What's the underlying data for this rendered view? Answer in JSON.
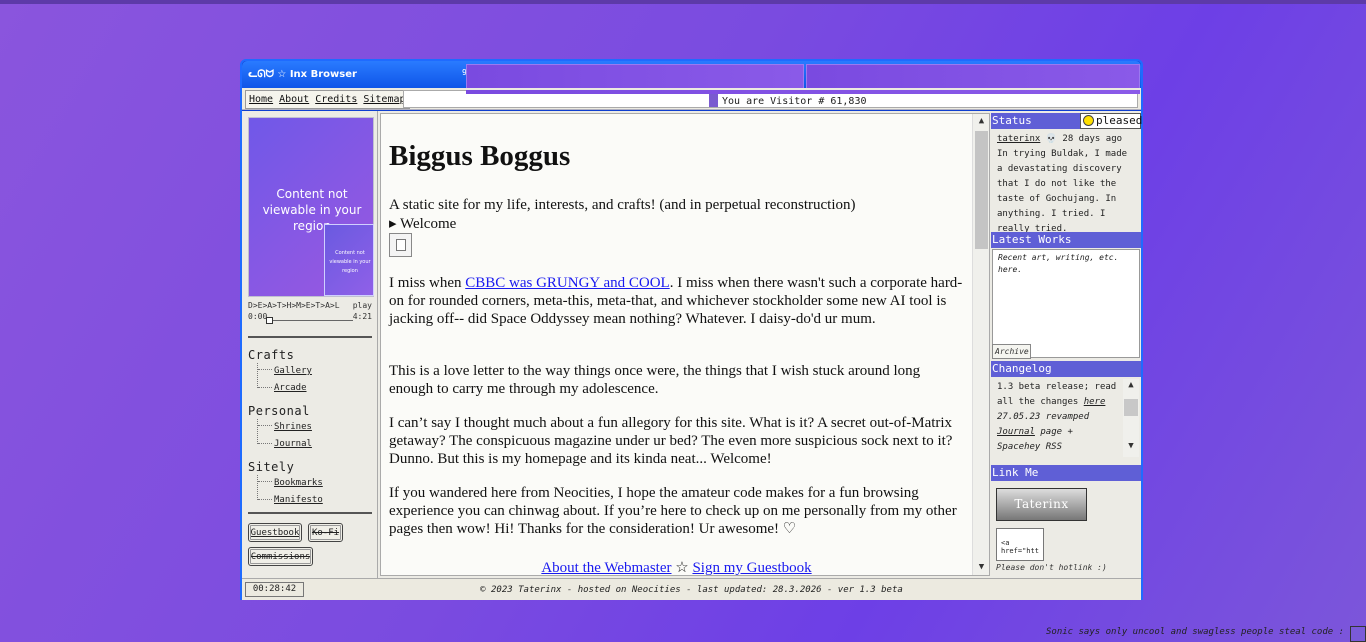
{
  "window": {
    "title": "ᓚᘏᗢ ☆ Inx Browser",
    "tab_number": "9"
  },
  "nav": {
    "items": [
      "Home",
      "About",
      "Credits",
      "Sitemap"
    ]
  },
  "visitor": "You are Visitor # 61,830",
  "player": {
    "blocked_message": "Content not viewable in your region",
    "mini_message": "Content not viewable in your region",
    "track_title": "D>E>A>T>H>M>E>T>A>L",
    "play_label": "play",
    "current_time": "0:00",
    "duration": "4:21",
    "progress": 0
  },
  "sidebar": {
    "sections": [
      {
        "title": "Crafts",
        "items": [
          "Gallery",
          "Arcade"
        ]
      },
      {
        "title": "Personal",
        "items": [
          "Shrines",
          "Journal"
        ]
      },
      {
        "title": "Sitely",
        "items": [
          "Bookmarks",
          "Manifesto"
        ]
      }
    ],
    "buttons": [
      "Guestbook",
      "Ko-Fi",
      "Commissions"
    ]
  },
  "main": {
    "heading": "Biggus Boggus",
    "tagline": "A static site for my life, interests, and crafts! (and in perpetual reconstruction)",
    "welcome_toggle": "▸ Welcome",
    "p1_before": "I miss when ",
    "p1_link": "CBBC was GRUNGY and COOL",
    "p1_after": ". I miss when there wasn't such a corporate hard-on for rounded corners, meta-this, meta-that, and whichever stockholder some new AI tool is jacking off-- did Space Oddyssey mean nothing? Whatever. I daisy-do'd ur mum.",
    "p2": "This is a love letter to the way things once were, the things that I wish stuck around long enough to carry me through my adolescence.",
    "p3": "I can’t say I thought much about a fun allegory for this site. What is it? A secret out-of-Matrix getaway? The conspicuous magazine under ur bed? The even more suspicious sock next to it? Dunno. But this is my homepage and its kinda neat... Welcome!",
    "p4": "If you wandered here from Neocities, I hope the amateur code makes for a fun browsing experience you can chinwag about. If you’re here to check up on me personally from my other pages then wow! Hi! Thanks for the consideration! Ur awesome! ♡",
    "link_webmaster": "About the Webmaster",
    "star": "☆",
    "link_guestbook": "Sign my Guestbook"
  },
  "status_panel": {
    "title": "Status",
    "mood": "pleased",
    "author": "taterinx",
    "skull": "💀",
    "when": "28 days ago",
    "text": "In trying Buldak, I made a devastating discovery that I do not like the taste of Gochujang. In anything. I tried. I really tried."
  },
  "latest_works": {
    "title": "Latest Works",
    "subtitle": "Recent art, writing, etc. here.",
    "archive": "Archive"
  },
  "changelog": {
    "title": "Changelog",
    "entry1_before": "1.3 beta release; read all the changes ",
    "entry1_link": "here",
    "entry2_date": "27.05.23",
    "entry2_text": " revamped ",
    "entry2_link": "Journal",
    "entry2_after": " page + Spacehey RSS"
  },
  "link_me": {
    "title": "Link Me",
    "banner": "Taterinx",
    "code": "<a href=\"htt",
    "note": "Please don't hotlink :)"
  },
  "statusbar": {
    "clock": "00:28:42",
    "footer": "© 2023 Taterinx - hosted on Neocities - last updated: 28.3.2026 - ver 1.3 beta"
  },
  "page_footer": "Sonic says only uncool and swagless people steal code :",
  "colors": {
    "accent": "#5f5fd6",
    "titlebar": "#1f6bff",
    "link": "#1a1aef",
    "background": "#7a4be0"
  }
}
